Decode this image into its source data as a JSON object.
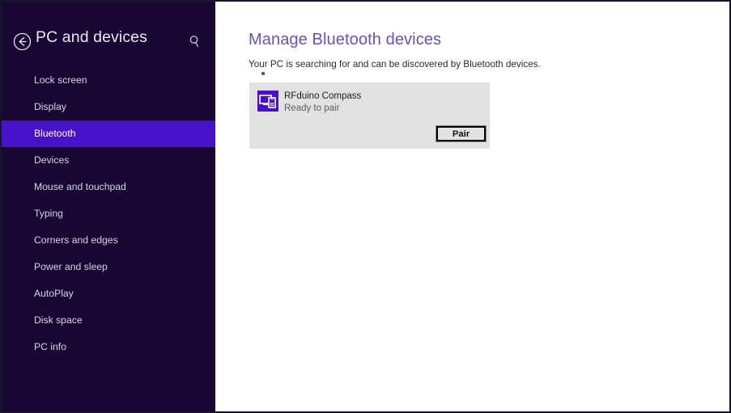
{
  "sidebar": {
    "back_icon": "back-arrow-circle-icon",
    "title": "PC and devices",
    "search_icon": "search-icon",
    "selected_index": 2,
    "items": [
      {
        "label": "Lock screen"
      },
      {
        "label": "Display"
      },
      {
        "label": "Bluetooth"
      },
      {
        "label": "Devices"
      },
      {
        "label": "Mouse and touchpad"
      },
      {
        "label": "Typing"
      },
      {
        "label": "Corners and edges"
      },
      {
        "label": "Power and sleep"
      },
      {
        "label": "AutoPlay"
      },
      {
        "label": "Disk space"
      },
      {
        "label": "PC info"
      }
    ]
  },
  "main": {
    "title": "Manage Bluetooth devices",
    "subtitle": "Your PC is searching for and can be discovered by Bluetooth devices.",
    "device": {
      "icon": "pc-and-phone-icon",
      "name": "RFduino Compass",
      "status": "Ready to pair",
      "action_label": "Pair"
    }
  },
  "colors": {
    "sidebar_bg": "#180733",
    "sidebar_selected": "#4611c8",
    "accent_title": "#6a4fbe",
    "card_bg": "#e2e2e2",
    "icon_bg": "#4611c8",
    "progress_dot": "#5a32c6",
    "window_border": "#15152b"
  }
}
